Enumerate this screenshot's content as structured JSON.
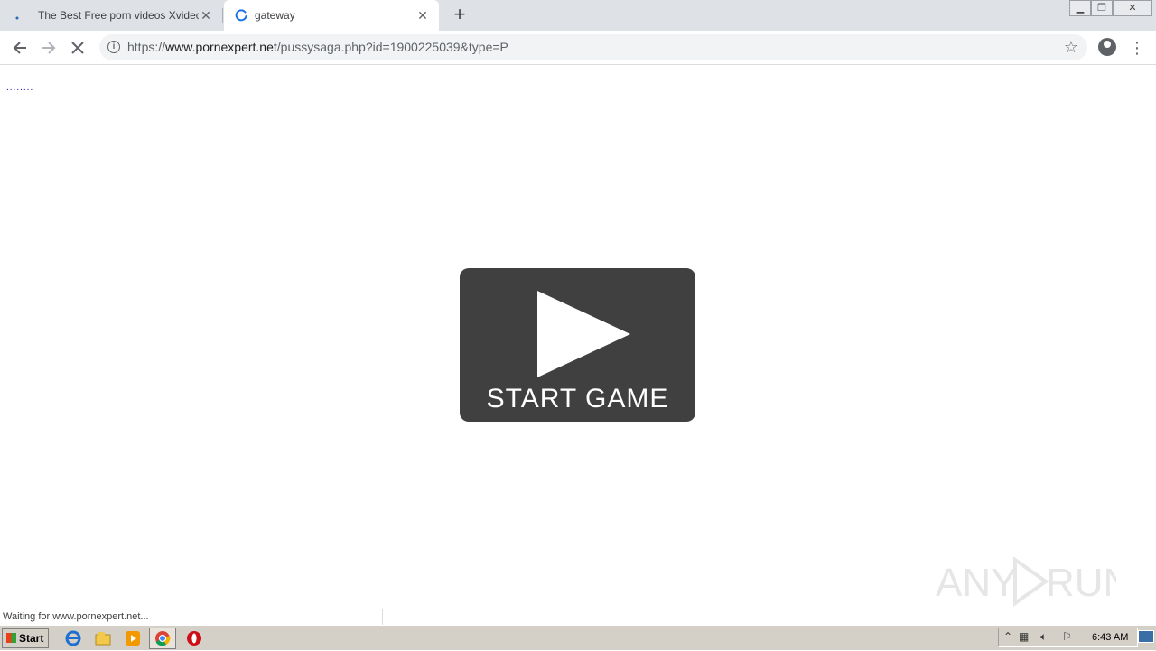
{
  "tabs": [
    {
      "title": "The Best Free porn videos Xvideos",
      "active": false
    },
    {
      "title": "gateway",
      "active": true
    }
  ],
  "toolbar": {
    "url_scheme": "https://",
    "url_host": "www.pornexpert.net",
    "url_path": "/pussysaga.php?id=1900225039&type=P"
  },
  "page": {
    "top_link": "........",
    "game_button_label": "START GAME"
  },
  "status": {
    "text": "Waiting for www.pornexpert.net..."
  },
  "watermark": "ANY RUN",
  "taskbar": {
    "start_label": "Start",
    "clock": "6:43 AM"
  },
  "colors": {
    "game_button_bg": "#404040",
    "tab_strip_bg": "#dee1e6",
    "loading_spinner": "#1a73e8"
  }
}
